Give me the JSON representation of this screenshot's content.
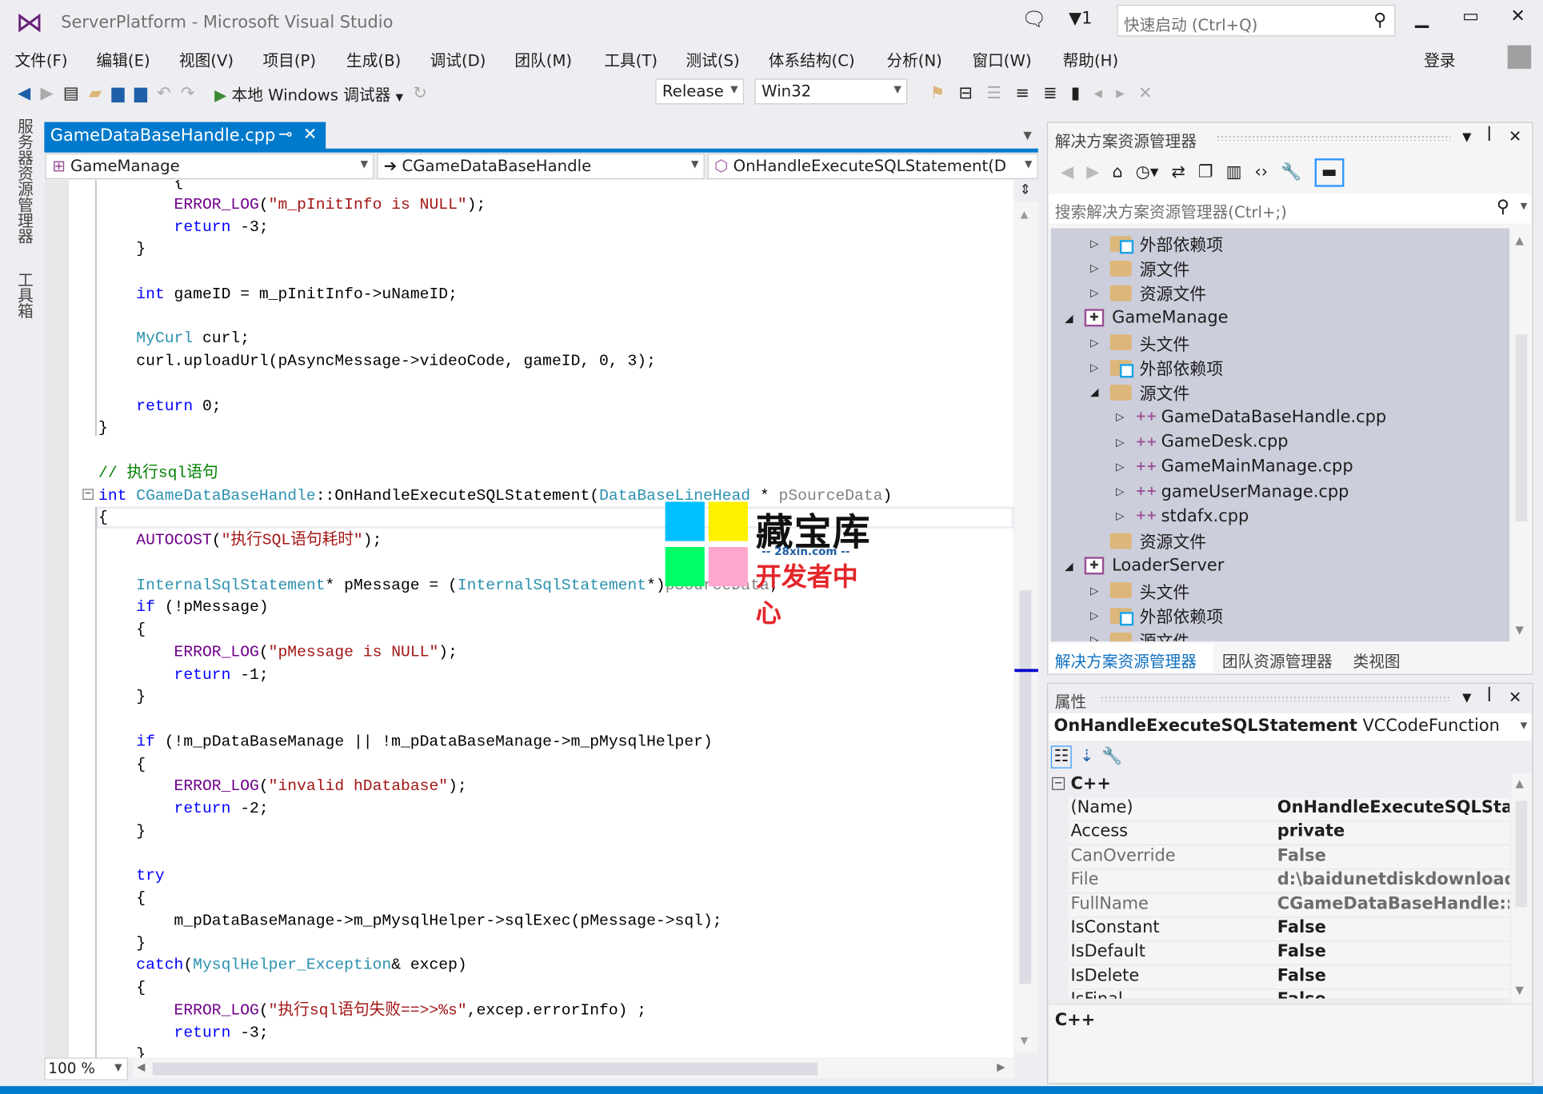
{
  "window": {
    "title": "ServerPlatform - Microsoft Visual Studio",
    "notifications": "1",
    "quick_launch_placeholder": "快速启动 (Ctrl+Q)",
    "sign_in": "登录"
  },
  "menu": [
    "文件(F)",
    "编辑(E)",
    "视图(V)",
    "项目(P)",
    "生成(B)",
    "调试(D)",
    "团队(M)",
    "工具(T)",
    "测试(S)",
    "体系结构(C)",
    "分析(N)",
    "窗口(W)",
    "帮助(H)"
  ],
  "toolbar": {
    "start_debugger": "本地 Windows 调试器",
    "configuration": "Release",
    "platform": "Win32"
  },
  "side_tabs": [
    "服务器资源管理器",
    "工具箱"
  ],
  "document_tab": {
    "label": "GameDataBaseHandle.cpp"
  },
  "nav": {
    "project": "GameManage",
    "class": "CGameDataBaseHandle",
    "member": "OnHandleExecuteSQLStatement(D"
  },
  "editor": {
    "zoom": "100 %",
    "lines": [
      [
        [
          "pl",
          "        {"
        ]
      ],
      [
        [
          "pl",
          "        "
        ],
        [
          "ma",
          "ERROR_LOG"
        ],
        [
          "pl",
          "("
        ],
        [
          "st",
          "\"m_pInitInfo is NULL\""
        ],
        [
          "pl",
          ");"
        ]
      ],
      [
        [
          "pl",
          "        "
        ],
        [
          "kw",
          "return"
        ],
        [
          "pl",
          " -3;"
        ]
      ],
      [
        [
          "pl",
          "    }"
        ]
      ],
      [],
      [
        [
          "pl",
          "    "
        ],
        [
          "kw",
          "int"
        ],
        [
          "pl",
          " gameID = m_pInitInfo->uNameID;"
        ]
      ],
      [],
      [
        [
          "pl",
          "    "
        ],
        [
          "ty",
          "MyCurl"
        ],
        [
          "pl",
          " curl;"
        ]
      ],
      [
        [
          "pl",
          "    curl.uploadUrl(pAsyncMessage->videoCode, gameID, 0, 3);"
        ]
      ],
      [],
      [
        [
          "pl",
          "    "
        ],
        [
          "kw",
          "return"
        ],
        [
          "pl",
          " 0;"
        ]
      ],
      [
        [
          "pl",
          "}"
        ]
      ],
      [],
      [
        [
          "cm",
          "// 执行sql语句"
        ]
      ],
      [
        [
          "kw",
          "int"
        ],
        [
          "pl",
          " "
        ],
        [
          "ty",
          "CGameDataBaseHandle"
        ],
        [
          "pl",
          "::OnHandleExecuteSQLStatement("
        ],
        [
          "ty",
          "DataBaseLineHead"
        ],
        [
          "pl",
          " * "
        ],
        [
          "pa",
          "pSourceData"
        ],
        [
          "pl",
          ")"
        ]
      ],
      [
        [
          "pl",
          "{"
        ]
      ],
      [
        [
          "pl",
          "    "
        ],
        [
          "ma",
          "AUTOCOST"
        ],
        [
          "pl",
          "("
        ],
        [
          "st",
          "\"执行SQL语句耗时\""
        ],
        [
          "pl",
          ");"
        ]
      ],
      [],
      [
        [
          "pl",
          "    "
        ],
        [
          "ty",
          "InternalSqlStatement"
        ],
        [
          "pl",
          "* pMessage = ("
        ],
        [
          "ty",
          "InternalSqlStatement"
        ],
        [
          "pl",
          "*)"
        ],
        [
          "pa",
          "pSourceData"
        ],
        [
          "pl",
          ";"
        ]
      ],
      [
        [
          "pl",
          "    "
        ],
        [
          "kw",
          "if"
        ],
        [
          "pl",
          " (!pMessage)"
        ]
      ],
      [
        [
          "pl",
          "    {"
        ]
      ],
      [
        [
          "pl",
          "        "
        ],
        [
          "ma",
          "ERROR_LOG"
        ],
        [
          "pl",
          "("
        ],
        [
          "st",
          "\"pMessage is NULL\""
        ],
        [
          "pl",
          ");"
        ]
      ],
      [
        [
          "pl",
          "        "
        ],
        [
          "kw",
          "return"
        ],
        [
          "pl",
          " -1;"
        ]
      ],
      [
        [
          "pl",
          "    }"
        ]
      ],
      [],
      [
        [
          "pl",
          "    "
        ],
        [
          "kw",
          "if"
        ],
        [
          "pl",
          " (!m_pDataBaseManage || !m_pDataBaseManage->m_pMysqlHelper)"
        ]
      ],
      [
        [
          "pl",
          "    {"
        ]
      ],
      [
        [
          "pl",
          "        "
        ],
        [
          "ma",
          "ERROR_LOG"
        ],
        [
          "pl",
          "("
        ],
        [
          "st",
          "\"invalid hDatabase\""
        ],
        [
          "pl",
          ");"
        ]
      ],
      [
        [
          "pl",
          "        "
        ],
        [
          "kw",
          "return"
        ],
        [
          "pl",
          " -2;"
        ]
      ],
      [
        [
          "pl",
          "    }"
        ]
      ],
      [],
      [
        [
          "pl",
          "    "
        ],
        [
          "kw",
          "try"
        ]
      ],
      [
        [
          "pl",
          "    {"
        ]
      ],
      [
        [
          "pl",
          "        m_pDataBaseManage->m_pMysqlHelper->sqlExec(pMessage->sql);"
        ]
      ],
      [
        [
          "pl",
          "    }"
        ]
      ],
      [
        [
          "pl",
          "    "
        ],
        [
          "kw",
          "catch"
        ],
        [
          "pl",
          "("
        ],
        [
          "ty",
          "MysqlHelper_Exception"
        ],
        [
          "pl",
          "& excep)"
        ]
      ],
      [
        [
          "pl",
          "    {"
        ]
      ],
      [
        [
          "pl",
          "        "
        ],
        [
          "ma",
          "ERROR_LOG"
        ],
        [
          "pl",
          "("
        ],
        [
          "st",
          "\"执行sql语句失败==>>%s\""
        ],
        [
          "pl",
          ",excep.errorInfo) ;"
        ]
      ],
      [
        [
          "pl",
          "        "
        ],
        [
          "kw",
          "return"
        ],
        [
          "pl",
          " -3;"
        ]
      ],
      [
        [
          "pl",
          "    }"
        ]
      ]
    ]
  },
  "watermark": {
    "title": "藏宝库",
    "url": "-- 28xin.com --",
    "subtitle": "开发者中心"
  },
  "solution_explorer": {
    "title": "解决方案资源管理器",
    "search_placeholder": "搜索解决方案资源管理器(Ctrl+;)",
    "tree": [
      {
        "label": "外部依赖项",
        "level": 1,
        "icon": "folder-ext",
        "state": "collapsed"
      },
      {
        "label": "源文件",
        "level": 1,
        "icon": "folder",
        "state": "collapsed"
      },
      {
        "label": "资源文件",
        "level": 1,
        "icon": "folder",
        "state": "collapsed"
      },
      {
        "label": "GameManage",
        "level": 0,
        "icon": "project",
        "state": "expanded"
      },
      {
        "label": "头文件",
        "level": 1,
        "icon": "folder",
        "state": "collapsed"
      },
      {
        "label": "外部依赖项",
        "level": 1,
        "icon": "folder-ext",
        "state": "collapsed"
      },
      {
        "label": "源文件",
        "level": 1,
        "icon": "folder",
        "state": "expanded"
      },
      {
        "label": "GameDataBaseHandle.cpp",
        "level": 2,
        "icon": "cpp",
        "state": "collapsed"
      },
      {
        "label": "GameDesk.cpp",
        "level": 2,
        "icon": "cpp",
        "state": "collapsed"
      },
      {
        "label": "GameMainManage.cpp",
        "level": 2,
        "icon": "cpp",
        "state": "collapsed"
      },
      {
        "label": "gameUserManage.cpp",
        "level": 2,
        "icon": "cpp",
        "state": "collapsed"
      },
      {
        "label": "stdafx.cpp",
        "level": 2,
        "icon": "cpp",
        "state": "collapsed"
      },
      {
        "label": "资源文件",
        "level": 1,
        "icon": "folder",
        "state": "none"
      },
      {
        "label": "LoaderServer",
        "level": 0,
        "icon": "project",
        "state": "expanded"
      },
      {
        "label": "头文件",
        "level": 1,
        "icon": "folder",
        "state": "collapsed"
      },
      {
        "label": "外部依赖项",
        "level": 1,
        "icon": "folder-ext",
        "state": "collapsed"
      },
      {
        "label": "源文件",
        "level": 1,
        "icon": "folder",
        "state": "collapsed"
      }
    ],
    "tabs": [
      "解决方案资源管理器",
      "团队资源管理器",
      "类视图"
    ]
  },
  "properties": {
    "title": "属性",
    "object_name": "OnHandleExecuteSQLStatement",
    "object_type": "VCCodeFunction",
    "category": "C++",
    "rows": [
      {
        "name": "(Name)",
        "value": "OnHandleExecuteSQLState",
        "dim": false
      },
      {
        "name": "Access",
        "value": "private",
        "dim": false
      },
      {
        "name": "CanOverride",
        "value": "False",
        "dim": true
      },
      {
        "name": "File",
        "value": "d:\\baidunetdiskdownload\\",
        "dim": true
      },
      {
        "name": "FullName",
        "value": "CGameDataBaseHandle::Or",
        "dim": true
      },
      {
        "name": "IsConstant",
        "value": "False",
        "dim": false
      },
      {
        "name": "IsDefault",
        "value": "False",
        "dim": false
      },
      {
        "name": "IsDelete",
        "value": "False",
        "dim": false
      },
      {
        "name": "IsFinal",
        "value": "False",
        "dim": false
      }
    ],
    "description": "C++"
  },
  "colors": {
    "accent": "#007acc",
    "keyword": "#0000ff",
    "type": "#2b91af",
    "string": "#a31515",
    "macro": "#6f008a",
    "comment": "#008000"
  }
}
